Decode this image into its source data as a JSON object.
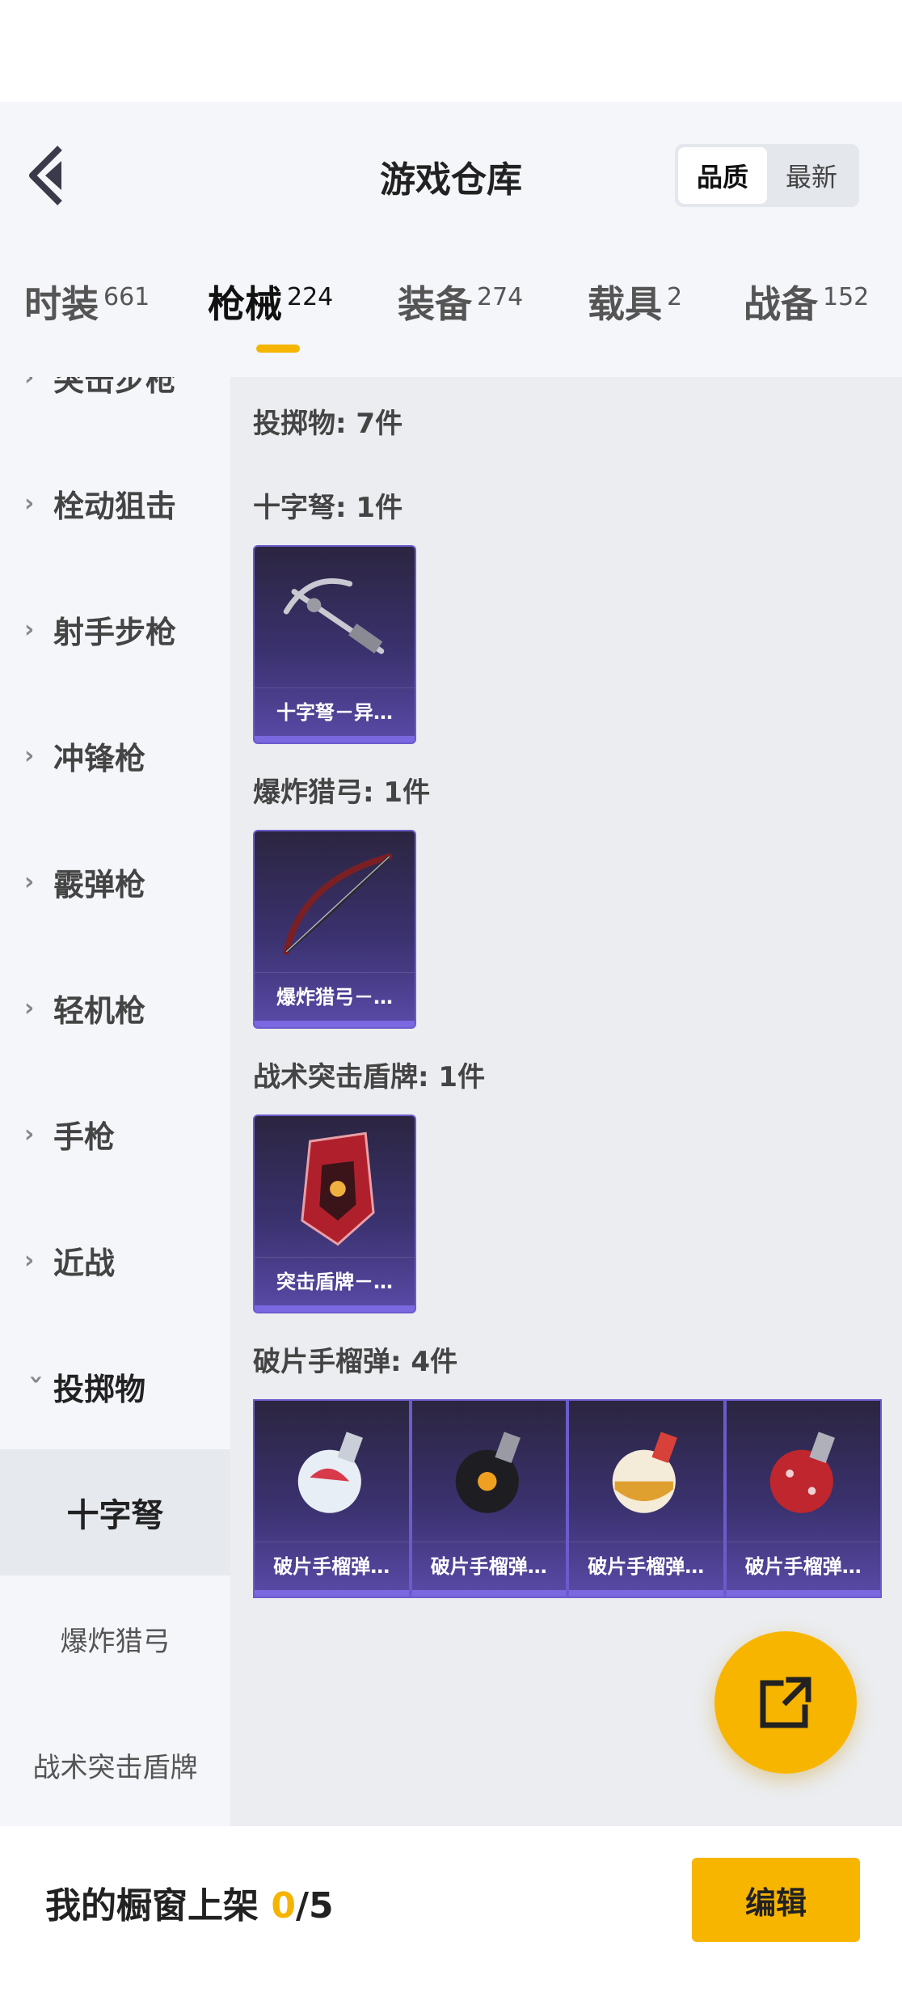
{
  "header": {
    "title": "游戏仓库",
    "sort_options": [
      {
        "label": "品质",
        "active": true
      },
      {
        "label": "最新",
        "active": false
      }
    ]
  },
  "tabs": [
    {
      "label": "时装",
      "count": "661"
    },
    {
      "label": "枪械",
      "count": "224",
      "active": true
    },
    {
      "label": "装备",
      "count": "274"
    },
    {
      "label": "载具",
      "count": "2"
    },
    {
      "label": "战备",
      "count": "152"
    }
  ],
  "sidebar": {
    "categories": [
      "突击步枪",
      "栓动狙击",
      "射手步枪",
      "冲锋枪",
      "霰弹枪",
      "轻机枪",
      "手枪",
      "近战",
      "投掷物"
    ],
    "sub_items": [
      "十字弩",
      "爆炸猎弓",
      "战术突击盾牌"
    ],
    "selected_sub": "十字弩"
  },
  "main": {
    "section_title": "投掷物: 7件",
    "groups": [
      {
        "title": "十字弩: 1件",
        "items": [
          "十字弩－异…"
        ]
      },
      {
        "title": "爆炸猎弓: 1件",
        "items": [
          "爆炸猎弓－…"
        ]
      },
      {
        "title": "战术突击盾牌: 1件",
        "items": [
          "突击盾牌－…"
        ]
      },
      {
        "title": "破片手榴弹: 4件",
        "items": [
          "破片手榴弹…",
          "破片手榴弹…",
          "破片手榴弹…",
          "破片手榴弹…"
        ]
      }
    ]
  },
  "bottom": {
    "showcase_label": "我的橱窗上架",
    "showcase_current": "0",
    "showcase_total": "/5",
    "edit_label": "编辑"
  },
  "colors": {
    "accent": "#f8b500",
    "card_purple": "#3b3270"
  },
  "icons": {
    "back": "back-arrow-icon",
    "share": "share-export-icon",
    "chevron": "chevron-right-icon"
  }
}
